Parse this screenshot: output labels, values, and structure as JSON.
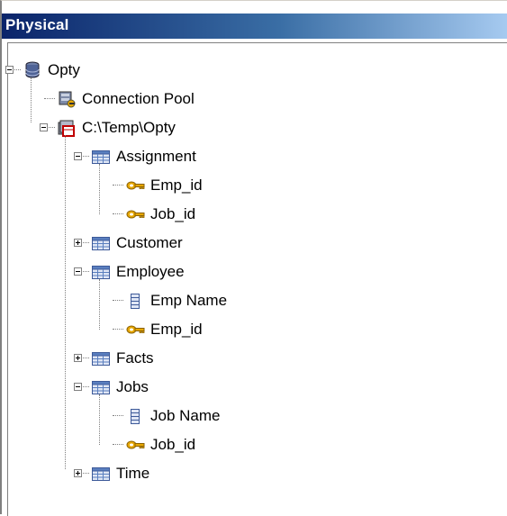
{
  "panel": {
    "title": "Physical"
  },
  "tree": {
    "root": {
      "label": "Opty",
      "icon": "database-icon",
      "expanded": true
    },
    "connection_pool": {
      "label": "Connection Pool",
      "icon": "connection-pool-icon"
    },
    "schema": {
      "label": "C:\\Temp\\Opty",
      "icon": "catalog-icon",
      "expanded": true
    },
    "tables": [
      {
        "label": "Assignment",
        "icon": "table-icon",
        "expanded": true,
        "columns": [
          {
            "label": "Emp_id",
            "icon": "key-icon"
          },
          {
            "label": "Job_id",
            "icon": "key-icon"
          }
        ]
      },
      {
        "label": "Customer",
        "icon": "table-icon",
        "expanded": false,
        "columns": []
      },
      {
        "label": "Employee",
        "icon": "table-icon",
        "expanded": true,
        "columns": [
          {
            "label": "Emp Name",
            "icon": "column-icon"
          },
          {
            "label": "Emp_id",
            "icon": "key-icon"
          }
        ]
      },
      {
        "label": "Facts",
        "icon": "table-icon",
        "expanded": false,
        "columns": []
      },
      {
        "label": "Jobs",
        "icon": "table-icon",
        "expanded": true,
        "columns": [
          {
            "label": "Job Name",
            "icon": "column-icon"
          },
          {
            "label": "Job_id",
            "icon": "key-icon"
          }
        ]
      },
      {
        "label": "Time",
        "icon": "table-icon",
        "expanded": false,
        "columns": []
      }
    ]
  },
  "colors": {
    "title_start": "#0a246a",
    "title_end": "#a6caf0",
    "key": "#e8a800",
    "table": "#5a7fbf"
  }
}
